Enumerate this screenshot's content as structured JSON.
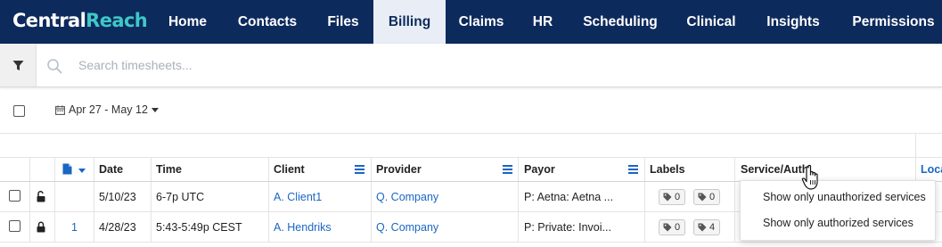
{
  "app": {
    "logo_part1": "Central",
    "logo_part2": "Reach",
    "brand_color": "#0d2a5c",
    "logo_accent": "#3ec8c8"
  },
  "nav": {
    "items": [
      {
        "label": "Home",
        "active": false
      },
      {
        "label": "Contacts",
        "active": false
      },
      {
        "label": "Files",
        "active": false
      },
      {
        "label": "Billing",
        "active": true
      },
      {
        "label": "Claims",
        "active": false
      },
      {
        "label": "HR",
        "active": false
      },
      {
        "label": "Scheduling",
        "active": false
      },
      {
        "label": "Clinical",
        "active": false
      },
      {
        "label": "Insights",
        "active": false
      },
      {
        "label": "Permissions",
        "active": false
      }
    ]
  },
  "search": {
    "placeholder": "Search timesheets...",
    "value": "",
    "filter_icon": "filter-icon",
    "search_icon": "search-icon"
  },
  "toolbar": {
    "date_range": "Apr 27 - May 12",
    "calendar_icon": "calendar-icon"
  },
  "table": {
    "columns": [
      "Date",
      "Time",
      "Client",
      "Provider",
      "Payor",
      "Labels",
      "Service/Auth",
      "Loca"
    ],
    "rows": [
      {
        "locked": false,
        "doc_count": "",
        "date": "5/10/23",
        "time": "6-7p UTC",
        "client": "A. Client1",
        "provider": "Q. Company",
        "payor": "P: Aetna: Aetna ...",
        "label_counts": [
          "0",
          "0"
        ]
      },
      {
        "locked": true,
        "doc_count": "1",
        "date": "4/28/23",
        "time": "5:43-5:49p CEST",
        "client": "A. Hendriks",
        "provider": "Q. Company",
        "payor": "P: Private: Invoi...",
        "label_counts": [
          "0",
          "4"
        ]
      }
    ]
  },
  "service_auth_menu": {
    "options": [
      "Show only unauthorized services",
      "Show only authorized services"
    ]
  },
  "colors": {
    "link": "#1a66c2",
    "active_tab_bg": "#e9eef6"
  }
}
